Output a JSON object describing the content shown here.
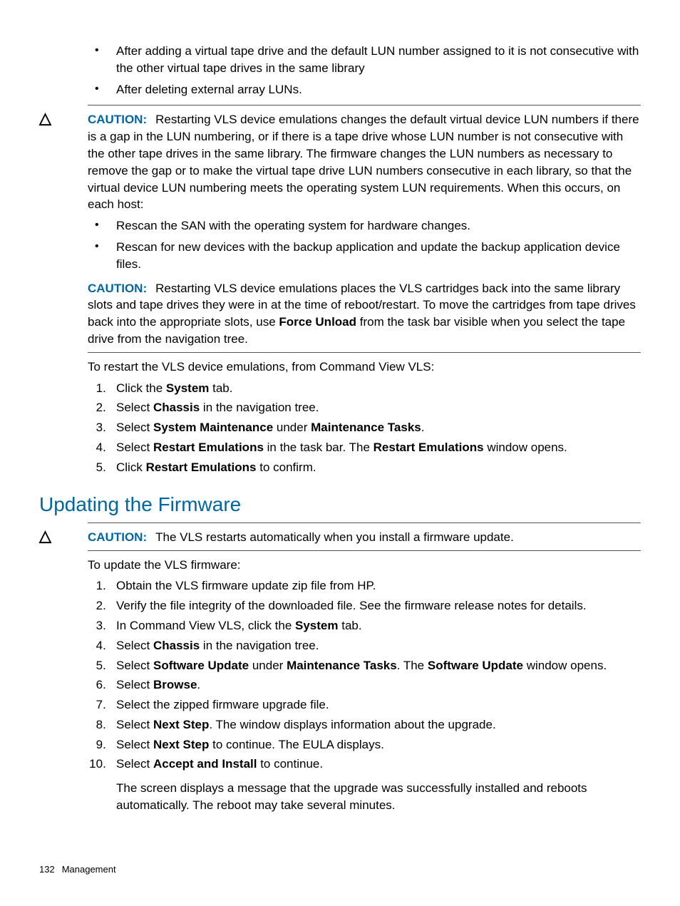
{
  "intro_bullets": [
    "After adding a virtual tape drive and the default LUN number assigned to it is not consecutive with the other virtual tape drives in the same library",
    "After deleting external array LUNs."
  ],
  "caution1": {
    "label": "CAUTION:",
    "text": "Restarting VLS device emulations changes the default virtual device LUN numbers if there is a gap in the LUN numbering, or if there is a tape drive whose LUN number is not consecutive with the other tape drives in the same library. The firmware changes the LUN numbers as necessary to remove the gap or to make the virtual tape drive LUN numbers consecutive in each library, so that the virtual device LUN numbering meets the operating system LUN requirements. When this occurs, on each host:",
    "bullets": [
      "Rescan the SAN with the operating system for hardware changes.",
      "Rescan for new devices with the backup application and update the backup application device files."
    ]
  },
  "caution2": {
    "label": "CAUTION:",
    "t1": "Restarting VLS device emulations places the VLS cartridges back into the same library slots and tape drives they were in at the time of reboot/restart. To move the cartridges from tape drives back into the appropriate slots, use ",
    "b1": "Force Unload",
    "t2": " from the task bar visible when you select the tape drive from the navigation tree."
  },
  "restart_intro": "To restart the VLS device emulations, from Command View VLS:",
  "restart_steps": {
    "s1a": "Click the ",
    "s1b": "System",
    "s1c": " tab.",
    "s2a": "Select ",
    "s2b": "Chassis",
    "s2c": " in the navigation tree.",
    "s3a": "Select ",
    "s3b": "System Maintenance",
    "s3c": " under ",
    "s3d": "Maintenance Tasks",
    "s3e": ".",
    "s4a": "Select ",
    "s4b": "Restart Emulations",
    "s4c": " in the task bar. The ",
    "s4d": "Restart Emulations",
    "s4e": " window opens.",
    "s5a": "Click ",
    "s5b": "Restart Emulations",
    "s5c": " to confirm."
  },
  "heading": "Updating the Firmware",
  "caution3": {
    "label": "CAUTION:",
    "text": "The VLS restarts automatically when you install a firmware update."
  },
  "update_intro": "To update the VLS firmware:",
  "update_steps": {
    "s1": "Obtain the VLS firmware update zip file from HP.",
    "s2": "Verify the file integrity of the downloaded file. See the firmware release notes for details.",
    "s3a": "In Command View VLS, click the ",
    "s3b": "System",
    "s3c": " tab.",
    "s4a": "Select ",
    "s4b": "Chassis",
    "s4c": " in the navigation tree.",
    "s5a": "Select ",
    "s5b": "Software Update",
    "s5c": " under ",
    "s5d": "Maintenance Tasks",
    "s5e": ". The ",
    "s5f": "Software Update",
    "s5g": " window opens.",
    "s6a": "Select ",
    "s6b": "Browse",
    "s6c": ".",
    "s7": "Select the zipped firmware upgrade file.",
    "s8a": "Select ",
    "s8b": "Next Step",
    "s8c": ". The window displays information about the upgrade.",
    "s9a": "Select ",
    "s9b": "Next Step",
    "s9c": " to continue. The EULA displays.",
    "s10a": "Select ",
    "s10b": "Accept and Install",
    "s10c": " to continue.",
    "s10_followup": "The screen displays a message that the upgrade was successfully installed and reboots automatically. The reboot may take several minutes."
  },
  "footer": {
    "page": "132",
    "section": "Management"
  }
}
